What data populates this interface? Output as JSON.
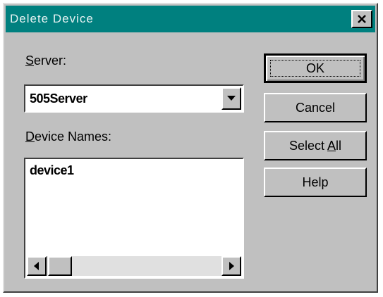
{
  "window": {
    "title": "Delete Device",
    "close_icon": "close-icon"
  },
  "server": {
    "label_accel": "S",
    "label_rest": "erver:",
    "selected_value": "505Server"
  },
  "devices": {
    "label_accel": "D",
    "label_rest": "evice Names:",
    "items": [
      "device1"
    ]
  },
  "buttons": {
    "ok": "OK",
    "cancel": "Cancel",
    "select_all_pre": "Select ",
    "select_all_accel": "A",
    "select_all_post": "ll",
    "help": "Help"
  },
  "colors": {
    "titlebar": "#00807f",
    "face": "#c0c0c0"
  }
}
